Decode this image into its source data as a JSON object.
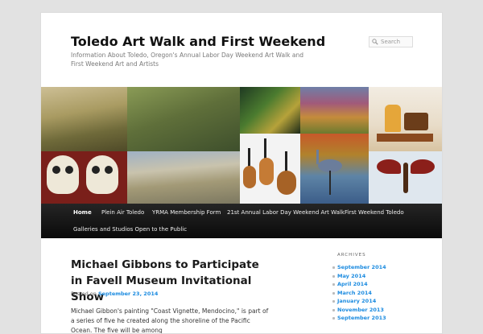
{
  "site": {
    "title": "Toledo Art Walk and First Weekend",
    "description": "Information About Toledo, Oregon's Annual Labor Day Weekend Art Walk and First Weekend Art and Artists"
  },
  "search": {
    "placeholder": "Search",
    "icon": "search-icon"
  },
  "nav": {
    "items": [
      "Home",
      "Plein Air Toledo",
      "YRMA Membership Form",
      "21st Annual Labor Day Weekend Art Walk",
      "First Weekend Toledo",
      "Galleries and Studios Open to the Public"
    ],
    "active": "Home"
  },
  "post": {
    "title": "Michael Gibbons to Participate in Favell Museum Invitational Show",
    "posted_prefix": "Posted on",
    "posted_date": "September 23, 2014",
    "excerpt": "Michael Gibbon's painting \"Coast Vignette, Mendocino,\" is part of a series of five he created along the shoreline of the Pacific Ocean. The five will be among"
  },
  "archives": {
    "heading": "ARCHIVES",
    "items": [
      "September 2014",
      "May 2014",
      "April 2014",
      "March 2014",
      "January 2014",
      "November 2013",
      "September 2013"
    ]
  },
  "colors": {
    "link": "#1b8be0",
    "nav_bg": "#151515",
    "page_bg": "#e2e2e2"
  }
}
